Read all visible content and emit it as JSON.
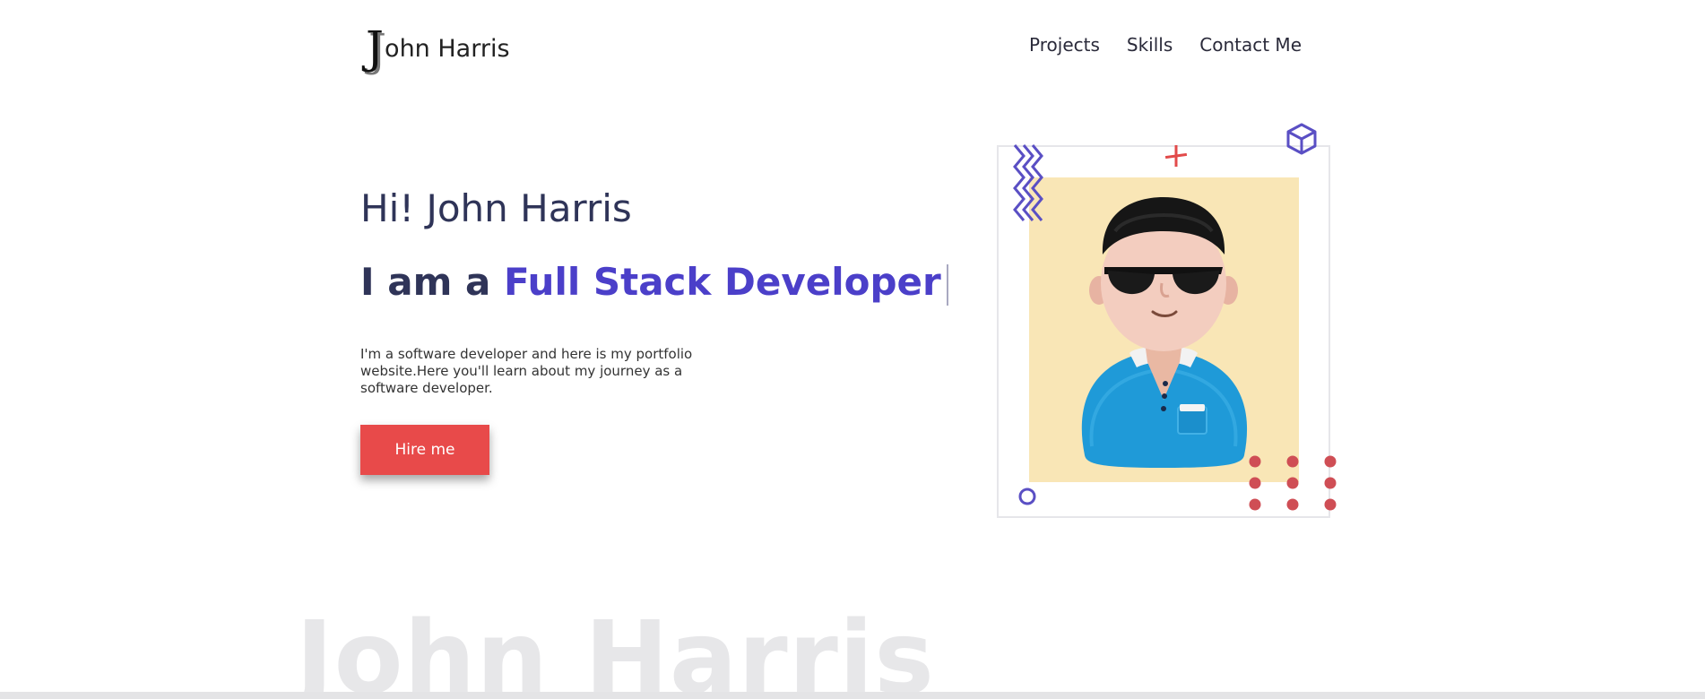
{
  "header": {
    "logo_initial": "J",
    "logo_rest": "ohn Harris",
    "nav": [
      {
        "label": "Projects"
      },
      {
        "label": "Skills"
      },
      {
        "label": "Contact Me"
      }
    ]
  },
  "hero": {
    "greeting": "Hi! John Harris",
    "role_prefix": "I am a ",
    "role": "Full Stack Developer",
    "intro": "I'm a software developer and here is my portfolio website.Here you'll learn about my journey as a software developer.",
    "cta_label": "Hire me"
  },
  "watermark": "John Harris",
  "colors": {
    "accent": "#4b3fc9",
    "heading": "#2f3458",
    "cta": "#e84a4a",
    "avatar_bg": "#f9e6b6"
  }
}
